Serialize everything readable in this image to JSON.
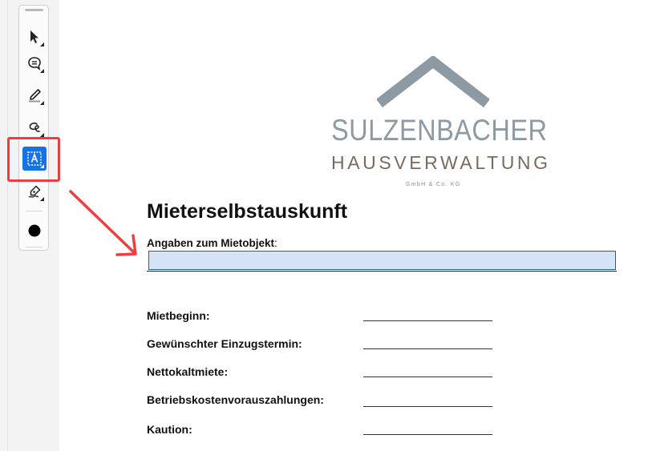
{
  "toolbar": {
    "tools": [
      {
        "name": "select-tool",
        "icon": "cursor-arrow-icon"
      },
      {
        "name": "comment-tool",
        "icon": "speech-bubble-icon"
      },
      {
        "name": "highlight-tool",
        "icon": "pen-highlight-icon"
      },
      {
        "name": "draw-tool",
        "icon": "freehand-loop-icon"
      },
      {
        "name": "text-field-tool",
        "icon": "text-field-recognition-icon",
        "active": true
      },
      {
        "name": "sign-tool",
        "icon": "signature-pen-icon"
      },
      {
        "name": "color-picker",
        "icon": "black-dot-icon"
      }
    ],
    "active_color": "#1473e6"
  },
  "annotation": {
    "highlight_color": "#ea4040"
  },
  "logo": {
    "title": "SULZENBACHER",
    "subtitle": "HAUSVERWALTUNG",
    "legal": "GmbH & Co. KG",
    "roof_color": "#8d9aa3",
    "subtitle_color": "#7a6a5e"
  },
  "document": {
    "title": "Mieterselbstauskunft",
    "object_label": "Angaben zum Mietobjekt",
    "object_label_suffix": ":",
    "object_field_value": "",
    "fields": [
      {
        "label": "Mietbeginn:",
        "value": ""
      },
      {
        "label": "Gewünschter Einzugstermin:",
        "value": ""
      },
      {
        "label": "Nettokaltmiete:",
        "value": ""
      },
      {
        "label": "Betriebskostenvorauszahlungen:",
        "value": ""
      },
      {
        "label": "Kaution:",
        "value": ""
      }
    ]
  }
}
